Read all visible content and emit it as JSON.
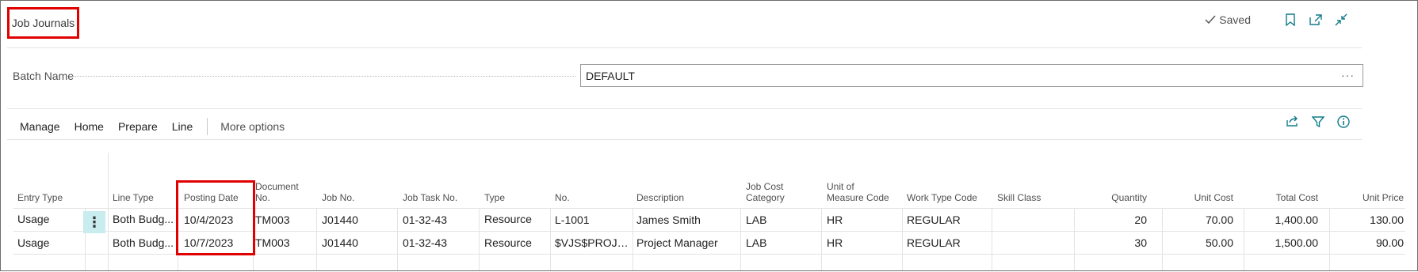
{
  "header": {
    "title": "Job Journals",
    "saved_label": "Saved"
  },
  "batch": {
    "label": "Batch Name",
    "value": "DEFAULT",
    "lookup_label": "···"
  },
  "actions": {
    "items": [
      "Manage",
      "Home",
      "Prepare",
      "Line"
    ],
    "more_label": "More options"
  },
  "table": {
    "columns": [
      "Entry Type",
      "Line Type",
      "Posting Date",
      "Document No.",
      "Job No.",
      "Job Task No.",
      "Type",
      "No.",
      "Description",
      "Job Cost Category",
      "Unit of Measure Code",
      "Work Type Code",
      "Skill Class",
      "Quantity",
      "Unit Cost",
      "Total Cost",
      "Unit Price"
    ],
    "column_headers_display": {
      "document_line1": "Document",
      "document_line2": "No.",
      "job_cost_line1": "Job Cost",
      "job_cost_line2": "Category",
      "uom_line1": "Unit of",
      "uom_line2": "Measure Code"
    },
    "rows": [
      {
        "entry_type": "Usage",
        "line_type": "Both Budg...",
        "posting_date": "10/4/2023",
        "document_no": "TM003",
        "job_no": "J01440",
        "job_task_no": "01-32-43",
        "type": "Resource",
        "no": "L-1001",
        "description": "James Smith",
        "job_cost_category": "LAB",
        "uom": "HR",
        "work_type": "REGULAR",
        "skill_class": "",
        "quantity": "20",
        "unit_cost": "70.00",
        "total_cost": "1,400.00",
        "unit_price": "130.00"
      },
      {
        "entry_type": "Usage",
        "line_type": "Both Budg...",
        "posting_date": "10/7/2023",
        "document_no": "TM003",
        "job_no": "J01440",
        "job_task_no": "01-32-43",
        "type": "Resource",
        "no": "$VJS$PROJM...",
        "description": "Project Manager",
        "job_cost_category": "LAB",
        "uom": "HR",
        "work_type": "REGULAR",
        "skill_class": "",
        "quantity": "30",
        "unit_cost": "50.00",
        "total_cost": "1,500.00",
        "unit_price": "90.00"
      }
    ],
    "row_action_glyph": "⋮"
  },
  "colors": {
    "accent": "#0f7b8a",
    "highlight": "#e00000",
    "row_action_bg": "#c9ecef"
  },
  "icons": [
    "check-icon",
    "bookmark-icon",
    "open-in-new-icon",
    "collapse-icon",
    "share-icon",
    "filter-icon",
    "info-icon"
  ]
}
